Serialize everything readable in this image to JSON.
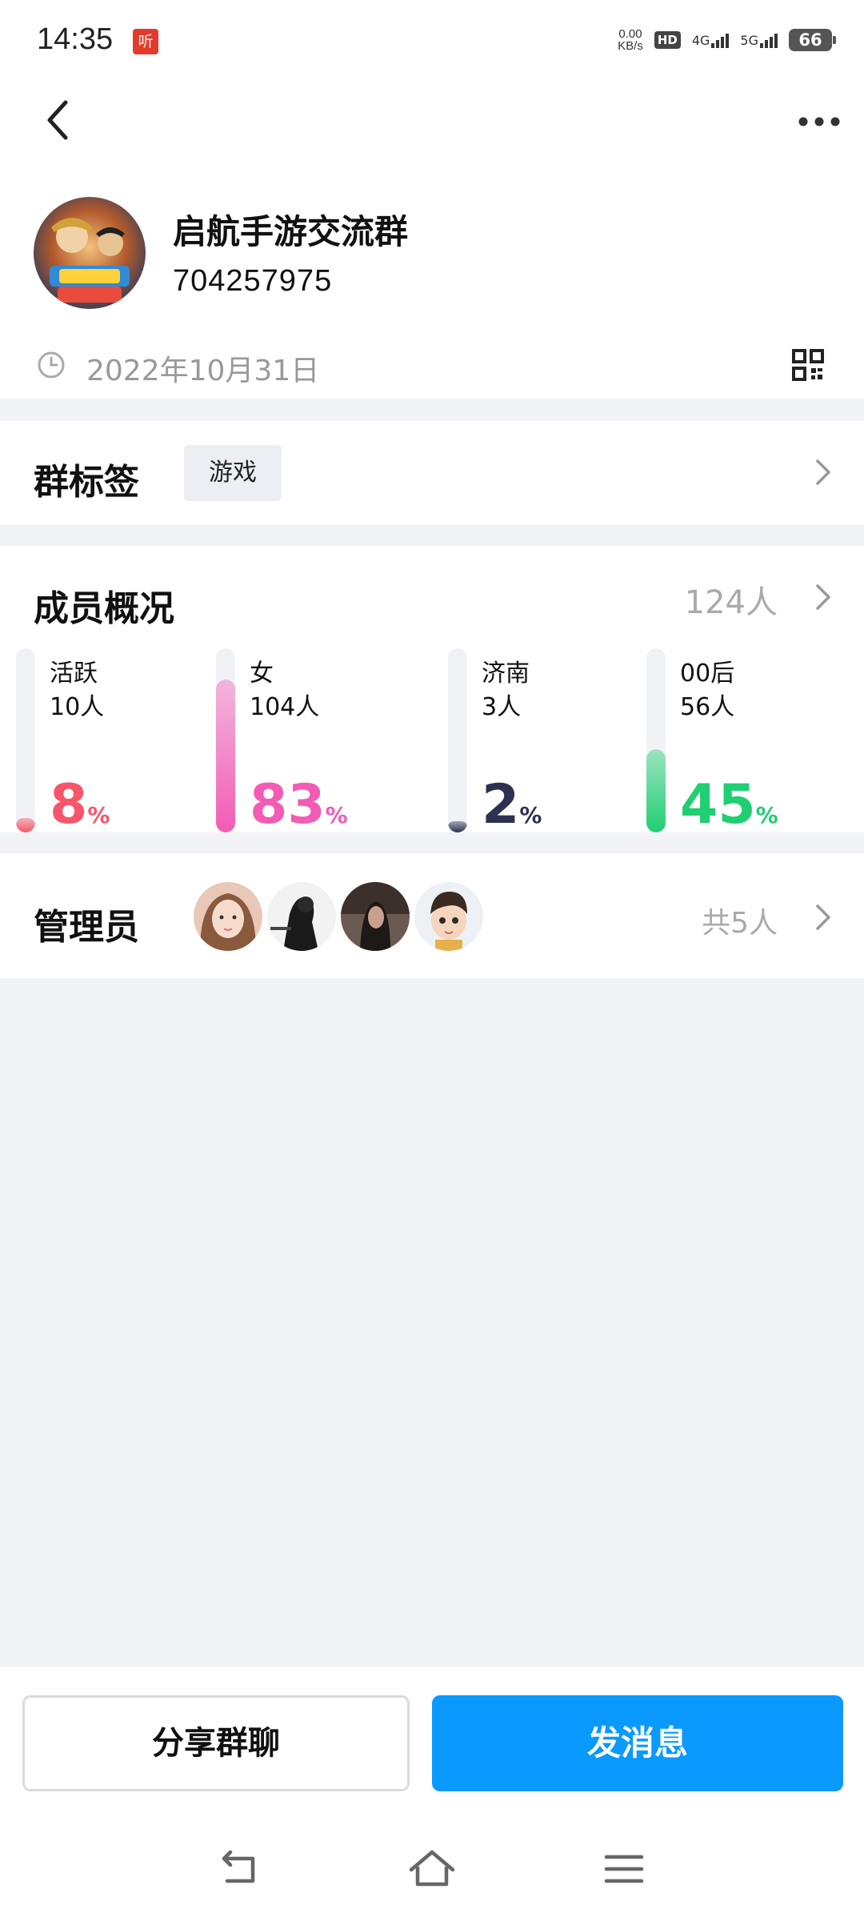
{
  "status_bar": {
    "time": "14:35",
    "app_badge": "听",
    "net_speed_value": "0.00",
    "net_speed_unit": "KB/s",
    "hd_badge": "HD",
    "sim1_label": "4G",
    "sim2_label": "5G",
    "battery": "66"
  },
  "header": {
    "group_name": "启航手游交流群",
    "group_id": "704257975",
    "created_date": "2022年10月31日",
    "icons": {
      "back": "back-arrow-icon",
      "more": "more-dots-icon",
      "clock": "clock-icon",
      "qr": "qr-code-icon"
    }
  },
  "tags": {
    "title": "群标签",
    "chip": "游戏"
  },
  "members": {
    "title": "成员概况",
    "count": "124人",
    "stats": [
      {
        "label": "活跃",
        "value": "10人",
        "percent": "8",
        "unit": "%",
        "ratio": 0.08,
        "color": "#f5566b"
      },
      {
        "label": "女",
        "value": "104人",
        "percent": "83",
        "unit": "%",
        "ratio": 0.83,
        "color": "#f25cb4"
      },
      {
        "label": "济南",
        "value": "3人",
        "percent": "2",
        "unit": "%",
        "ratio": 0.02,
        "color": "#2e3150"
      },
      {
        "label": "00后",
        "value": "56人",
        "percent": "45",
        "unit": "%",
        "ratio": 0.45,
        "color": "#1fcf72"
      }
    ]
  },
  "admins": {
    "title": "管理员",
    "count": "共5人"
  },
  "actions": {
    "share": "分享群聊",
    "send": "发消息"
  },
  "navbar": {
    "icons": [
      "back-nav-icon",
      "home-nav-icon",
      "menu-nav-icon"
    ]
  }
}
